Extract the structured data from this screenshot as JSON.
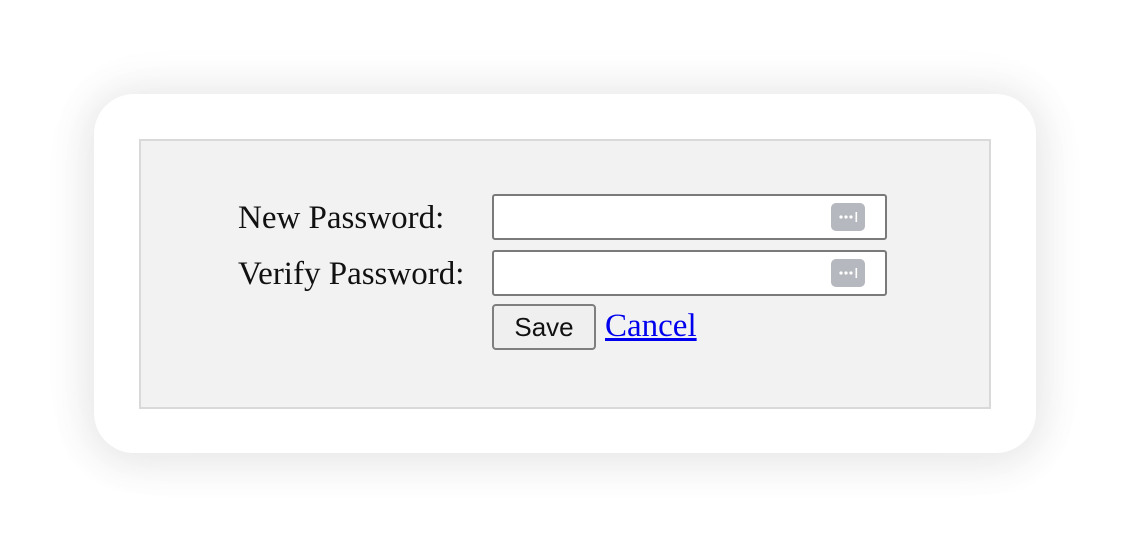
{
  "form": {
    "new_password_label": "New Password:",
    "verify_password_label": "Verify Password:",
    "new_password_value": "",
    "verify_password_value": "",
    "save_label": "Save",
    "cancel_label": "Cancel"
  },
  "icons": {
    "password_field_icon": "password-manager-icon"
  },
  "colors": {
    "panel_background": "#f2f2f2",
    "link": "#0000ee",
    "field_icon": "#b6b8bf"
  }
}
